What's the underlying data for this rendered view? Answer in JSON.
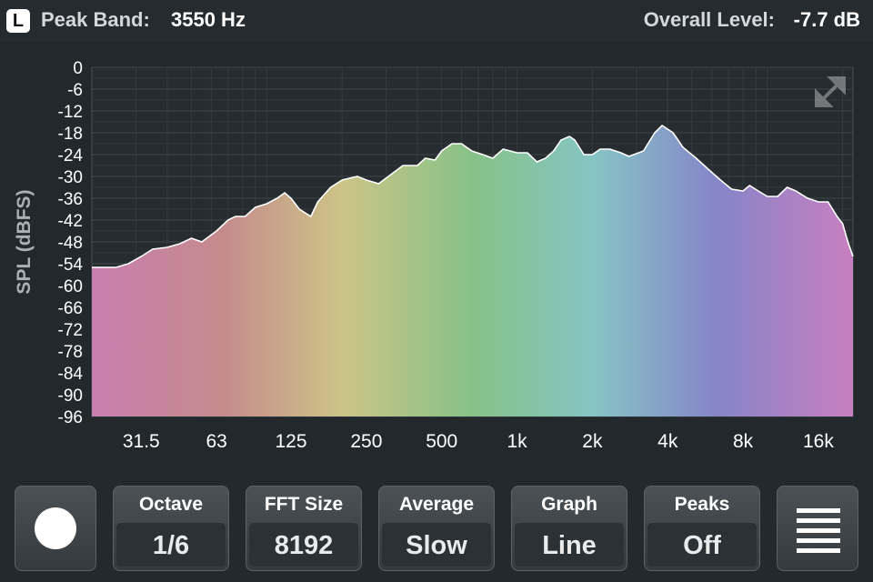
{
  "header": {
    "channel": "L",
    "peak_label": "Peak Band:",
    "peak_value": "3550 Hz",
    "level_label": "Overall Level:",
    "level_value": "-7.7 dB"
  },
  "controls": {
    "octave": {
      "label": "Octave",
      "value": "1/6"
    },
    "fft": {
      "label": "FFT Size",
      "value": "8192"
    },
    "average": {
      "label": "Average",
      "value": "Slow"
    },
    "graph": {
      "label": "Graph",
      "value": "Line"
    },
    "peaks": {
      "label": "Peaks",
      "value": "Off"
    }
  },
  "icons": {
    "record": "record-icon",
    "menu": "menu-icon",
    "expand": "expand-icon"
  },
  "colors": {
    "background": "#252b2e",
    "grid": "#3a4043",
    "spectrum_line": "#ffffff"
  },
  "chart_data": {
    "type": "area",
    "ylabel": "SPL (dBFS)",
    "ylim": [
      -96,
      0
    ],
    "y_ticks": [
      "0",
      "-6",
      "-12",
      "-18",
      "-24",
      "-30",
      "-36",
      "-42",
      "-48",
      "-54",
      "-60",
      "-66",
      "-72",
      "-78",
      "-84",
      "-90",
      "-96"
    ],
    "x_scale": "log",
    "x_ticks": [
      {
        "label": "31.5",
        "hz": 31.5
      },
      {
        "label": "63",
        "hz": 63
      },
      {
        "label": "125",
        "hz": 125
      },
      {
        "label": "250",
        "hz": 250
      },
      {
        "label": "500",
        "hz": 500
      },
      {
        "label": "1k",
        "hz": 1000
      },
      {
        "label": "2k",
        "hz": 2000
      },
      {
        "label": "4k",
        "hz": 4000
      },
      {
        "label": "8k",
        "hz": 8000
      },
      {
        "label": "16k",
        "hz": 16000
      }
    ],
    "xlim": [
      20,
      22000
    ],
    "grid": true,
    "points": [
      [
        20,
        -55
      ],
      [
        25,
        -55
      ],
      [
        28,
        -54
      ],
      [
        31.5,
        -52
      ],
      [
        35,
        -50
      ],
      [
        40,
        -49.5
      ],
      [
        45,
        -48.5
      ],
      [
        50,
        -47
      ],
      [
        55,
        -48
      ],
      [
        63,
        -45
      ],
      [
        70,
        -42
      ],
      [
        75,
        -41
      ],
      [
        82,
        -41
      ],
      [
        90,
        -38.5
      ],
      [
        100,
        -37.5
      ],
      [
        110,
        -36
      ],
      [
        118,
        -34.5
      ],
      [
        125,
        -36
      ],
      [
        135,
        -39
      ],
      [
        150,
        -41
      ],
      [
        160,
        -37
      ],
      [
        180,
        -33
      ],
      [
        200,
        -31
      ],
      [
        230,
        -30
      ],
      [
        250,
        -31
      ],
      [
        280,
        -32
      ],
      [
        320,
        -29
      ],
      [
        350,
        -27
      ],
      [
        400,
        -27
      ],
      [
        430,
        -25
      ],
      [
        470,
        -25.5
      ],
      [
        500,
        -23
      ],
      [
        550,
        -21
      ],
      [
        600,
        -21
      ],
      [
        660,
        -23
      ],
      [
        730,
        -24
      ],
      [
        800,
        -25
      ],
      [
        880,
        -22.5
      ],
      [
        1000,
        -23.5
      ],
      [
        1100,
        -23.5
      ],
      [
        1200,
        -26
      ],
      [
        1300,
        -25
      ],
      [
        1400,
        -23
      ],
      [
        1500,
        -20
      ],
      [
        1620,
        -19
      ],
      [
        1700,
        -20
      ],
      [
        1850,
        -24
      ],
      [
        2000,
        -24
      ],
      [
        2150,
        -22.5
      ],
      [
        2350,
        -22.5
      ],
      [
        2600,
        -23.5
      ],
      [
        2800,
        -24.5
      ],
      [
        3200,
        -23
      ],
      [
        3550,
        -18
      ],
      [
        3800,
        -16
      ],
      [
        4200,
        -18
      ],
      [
        4600,
        -22
      ],
      [
        5200,
        -25
      ],
      [
        5800,
        -28
      ],
      [
        6500,
        -31
      ],
      [
        7200,
        -33.5
      ],
      [
        8000,
        -34
      ],
      [
        8500,
        -32.5
      ],
      [
        9200,
        -34
      ],
      [
        10000,
        -35.5
      ],
      [
        11000,
        -35.5
      ],
      [
        12000,
        -33
      ],
      [
        13000,
        -34
      ],
      [
        14500,
        -36
      ],
      [
        16000,
        -37
      ],
      [
        17500,
        -37
      ],
      [
        19000,
        -41
      ],
      [
        20000,
        -43
      ],
      [
        21000,
        -48
      ],
      [
        22000,
        -52
      ]
    ]
  }
}
